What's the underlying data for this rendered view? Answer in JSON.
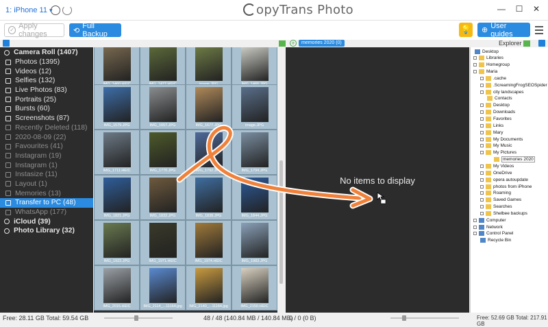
{
  "titlebar": {
    "device": "1: iPhone 11",
    "app_title": "CopyTrans Photo",
    "title_rest": "opyTrans Photo"
  },
  "toolbar": {
    "apply_label": "Apply changes",
    "backup_label": "Full Backup",
    "guides_label": "User guides"
  },
  "tabs": {
    "preview_tab": "memories 2020 (0)",
    "explorer_label": "Explorer"
  },
  "sidebar": {
    "items": [
      {
        "label": "Camera Roll (1407)",
        "bold": true,
        "indent": false,
        "dim": false
      },
      {
        "label": "Photos (1395)",
        "bold": false,
        "indent": true,
        "dim": false
      },
      {
        "label": "Videos (12)",
        "bold": false,
        "indent": true,
        "dim": false
      },
      {
        "label": "Selfies (132)",
        "bold": false,
        "indent": true,
        "dim": false
      },
      {
        "label": "Live Photos (83)",
        "bold": false,
        "indent": true,
        "dim": false
      },
      {
        "label": "Portraits (25)",
        "bold": false,
        "indent": true,
        "dim": false
      },
      {
        "label": "Bursts (60)",
        "bold": false,
        "indent": true,
        "dim": false
      },
      {
        "label": "Screenshots (87)",
        "bold": false,
        "indent": true,
        "dim": false
      },
      {
        "label": "Recently Deleted (118)",
        "bold": false,
        "indent": true,
        "dim": true
      },
      {
        "label": "2020-08-09 (22)",
        "bold": false,
        "indent": true,
        "dim": true
      },
      {
        "label": "Favourites (41)",
        "bold": false,
        "indent": true,
        "dim": true
      },
      {
        "label": "Instagram (19)",
        "bold": false,
        "indent": true,
        "dim": true
      },
      {
        "label": "Instagram (1)",
        "bold": false,
        "indent": true,
        "dim": true
      },
      {
        "label": "Instasize (11)",
        "bold": false,
        "indent": true,
        "dim": true
      },
      {
        "label": "Layout (1)",
        "bold": false,
        "indent": true,
        "dim": true
      },
      {
        "label": "Memories (13)",
        "bold": false,
        "indent": true,
        "dim": true
      },
      {
        "label": "Transfer to PC (48)",
        "bold": false,
        "indent": true,
        "dim": false,
        "selected": true
      },
      {
        "label": "WhatsApp (177)",
        "bold": false,
        "indent": true,
        "dim": true
      },
      {
        "label": "iCloud (39)",
        "bold": true,
        "indent": false,
        "dim": false
      },
      {
        "label": "Photo Library (32)",
        "bold": true,
        "indent": false,
        "dim": false
      }
    ]
  },
  "photos": [
    {
      "caption": "IMG_1460.HEIC",
      "color": "#7a6a50"
    },
    {
      "caption": "IMG_1477.HEIC",
      "color": "#5d6b3a"
    },
    {
      "caption": "image.JPG",
      "color": "#6f7d46"
    },
    {
      "caption": "IMG_1466.JPG",
      "color": "#cfcfc8"
    },
    {
      "caption": "IMG_1579.JPG",
      "color": "#3d6ea8"
    },
    {
      "caption": "IMG_1657.JPG",
      "color": "#8a8d8f"
    },
    {
      "caption": "IMG_1677.JPG",
      "color": "#b08a5a"
    },
    {
      "caption": "image.JPG",
      "color": "#5a6f8a"
    },
    {
      "caption": "IMG_1711.HEIC",
      "color": "#6d7a86"
    },
    {
      "caption": "IMG_1770.JPG",
      "color": "#4d5a2a"
    },
    {
      "caption": "IMG_1792.JPG",
      "color": "#4e6a9a"
    },
    {
      "caption": "IMG_1794.JPG",
      "color": "#7a8da0"
    },
    {
      "caption": "IMG_1821.JPG",
      "color": "#2f5e9a"
    },
    {
      "caption": "IMG_1832.JPG",
      "color": "#6e5a3e"
    },
    {
      "caption": "IMG_1838.JPG",
      "color": "#3f6ea0"
    },
    {
      "caption": "IMG_1844.JPG",
      "color": "#2c5a9a"
    },
    {
      "caption": "IMG_1922.JPG",
      "color": "#6a7a50"
    },
    {
      "caption": "IMG_1971.HEIC",
      "color": "#3a3a2a"
    },
    {
      "caption": "IMG_1974.HEIC",
      "color": "#a07a3a"
    },
    {
      "caption": "IMG_1983.JPG",
      "color": "#8aa0b8"
    },
    {
      "caption": "IMG_2015.HEIC",
      "color": "#9aa0a6"
    },
    {
      "caption": "IMG_2114_...11164.jpg",
      "color": "#5a8ad0"
    },
    {
      "caption": "IMG_2140_...11164.jpg",
      "color": "#c89a40"
    },
    {
      "caption": "IMG_2150.HEIC",
      "color": "#d8d0c0"
    }
  ],
  "preview": {
    "empty_text": "No items to display"
  },
  "explorer": {
    "items": [
      {
        "label": "Desktop",
        "level": 0,
        "toggle": false,
        "selected": false
      },
      {
        "label": "Libraries",
        "level": 1,
        "toggle": true,
        "selected": false
      },
      {
        "label": "Homegroup",
        "level": 1,
        "toggle": true,
        "selected": false
      },
      {
        "label": "Maria",
        "level": 1,
        "toggle": true,
        "selected": false
      },
      {
        "label": ".cache",
        "level": 2,
        "toggle": true,
        "selected": false
      },
      {
        "label": ".ScreamingFrogSEOSpider",
        "level": 2,
        "toggle": true,
        "selected": false
      },
      {
        "label": "city landscapes",
        "level": 2,
        "toggle": true,
        "selected": false
      },
      {
        "label": "Contacts",
        "level": 2,
        "toggle": false,
        "selected": false
      },
      {
        "label": "Desktop",
        "level": 2,
        "toggle": true,
        "selected": false
      },
      {
        "label": "Downloads",
        "level": 2,
        "toggle": true,
        "selected": false
      },
      {
        "label": "Favorites",
        "level": 2,
        "toggle": true,
        "selected": false
      },
      {
        "label": "Links",
        "level": 2,
        "toggle": true,
        "selected": false
      },
      {
        "label": "Mary",
        "level": 2,
        "toggle": true,
        "selected": false
      },
      {
        "label": "My Documents",
        "level": 2,
        "toggle": true,
        "selected": false
      },
      {
        "label": "My Music",
        "level": 2,
        "toggle": true,
        "selected": false
      },
      {
        "label": "My Pictures",
        "level": 2,
        "toggle": true,
        "selected": false
      },
      {
        "label": "memories 2020",
        "level": 3,
        "toggle": false,
        "selected": true
      },
      {
        "label": "My Videos",
        "level": 2,
        "toggle": true,
        "selected": false
      },
      {
        "label": "OneDrive",
        "level": 2,
        "toggle": true,
        "selected": false
      },
      {
        "label": "opera autoupdate",
        "level": 2,
        "toggle": true,
        "selected": false
      },
      {
        "label": "photos from iPhone",
        "level": 2,
        "toggle": true,
        "selected": false
      },
      {
        "label": "Roaming",
        "level": 2,
        "toggle": true,
        "selected": false
      },
      {
        "label": "Saved Games",
        "level": 2,
        "toggle": true,
        "selected": false
      },
      {
        "label": "Searches",
        "level": 2,
        "toggle": true,
        "selected": false
      },
      {
        "label": "Shelbee backups",
        "level": 2,
        "toggle": true,
        "selected": false
      },
      {
        "label": "Computer",
        "level": 1,
        "toggle": true,
        "selected": false
      },
      {
        "label": "Network",
        "level": 1,
        "toggle": true,
        "selected": false
      },
      {
        "label": "Control Panel",
        "level": 1,
        "toggle": true,
        "selected": false
      },
      {
        "label": "Recycle Bin",
        "level": 1,
        "toggle": false,
        "selected": false
      }
    ]
  },
  "status": {
    "left_free": "Free: 28.11 GB Total: 59.54 GB",
    "grid_count": "48 / 48 (140.84 MB / 140.84 MB)",
    "preview_count": "0 / 0 (0 B)",
    "right_free": "Free: 52.69 GB Total: 217.91 GB"
  },
  "colors": {
    "accent": "#2a8be0",
    "sidebar_bg": "#2c2c2c",
    "bulb": "#f5b914",
    "drag_arrow": "#f0813a"
  }
}
